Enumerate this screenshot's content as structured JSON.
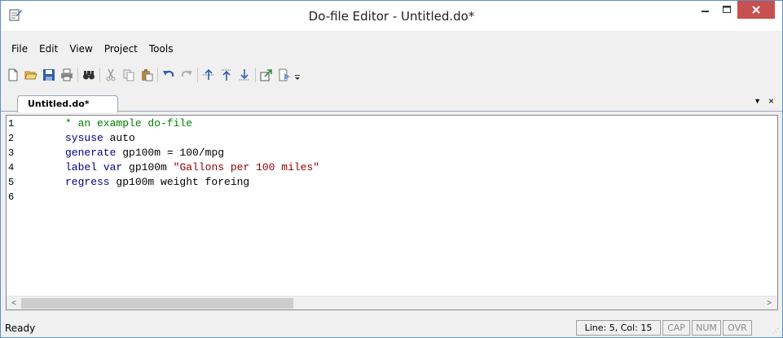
{
  "window": {
    "title": "Do-file Editor - Untitled.do*",
    "buttons": {
      "minimize": "–",
      "maximize": "□",
      "close": "×"
    },
    "close_color": "#c75050",
    "border_color": "#5b8fc9"
  },
  "menu": {
    "items": [
      "File",
      "Edit",
      "View",
      "Project",
      "Tools"
    ]
  },
  "toolbar": {
    "icons": [
      "new-document-icon",
      "open-folder-icon",
      "save-icon",
      "print-icon",
      "find-icon",
      "cut-icon",
      "copy-icon",
      "paste-icon",
      "undo-icon",
      "redo-icon",
      "toggle-bookmark-icon",
      "previous-bookmark-icon",
      "next-bookmark-icon",
      "show-file-in-viewer-icon",
      "execute-icon",
      "toolbar-options-icon"
    ]
  },
  "tab": {
    "label": "Untitled.do*",
    "menu_glyph": "▼",
    "close_glyph": "×"
  },
  "editor": {
    "line_numbers": [
      "1",
      "2",
      "3",
      "4",
      "5",
      "6"
    ],
    "lines": [
      [
        {
          "t": "* an example do-file",
          "c": "comment"
        }
      ],
      [
        {
          "t": "sysuse",
          "c": "kw"
        },
        {
          "t": " auto",
          "c": "plain"
        }
      ],
      [
        {
          "t": "generate",
          "c": "kw"
        },
        {
          "t": " gp100m = 100/mpg",
          "c": "plain"
        }
      ],
      [
        {
          "t": "label",
          "c": "kw"
        },
        {
          "t": " ",
          "c": "plain"
        },
        {
          "t": "var",
          "c": "kw"
        },
        {
          "t": " gp100m ",
          "c": "plain"
        },
        {
          "t": "\"Gallons per 100 miles\"",
          "c": "str"
        }
      ],
      [
        {
          "t": "regress",
          "c": "kw"
        },
        {
          "t": " gp100m weight foreing",
          "c": "plain"
        }
      ],
      []
    ],
    "colors": {
      "comment": "#008000",
      "keyword": "#00008b",
      "string": "#8b0000"
    }
  },
  "scrollbar": {
    "left_arrow": "<",
    "right_arrow": ">"
  },
  "status": {
    "text": "Ready",
    "position": "Line: 5, Col: 15",
    "cap": "CAP",
    "num": "NUM",
    "ovr": "OVR"
  }
}
